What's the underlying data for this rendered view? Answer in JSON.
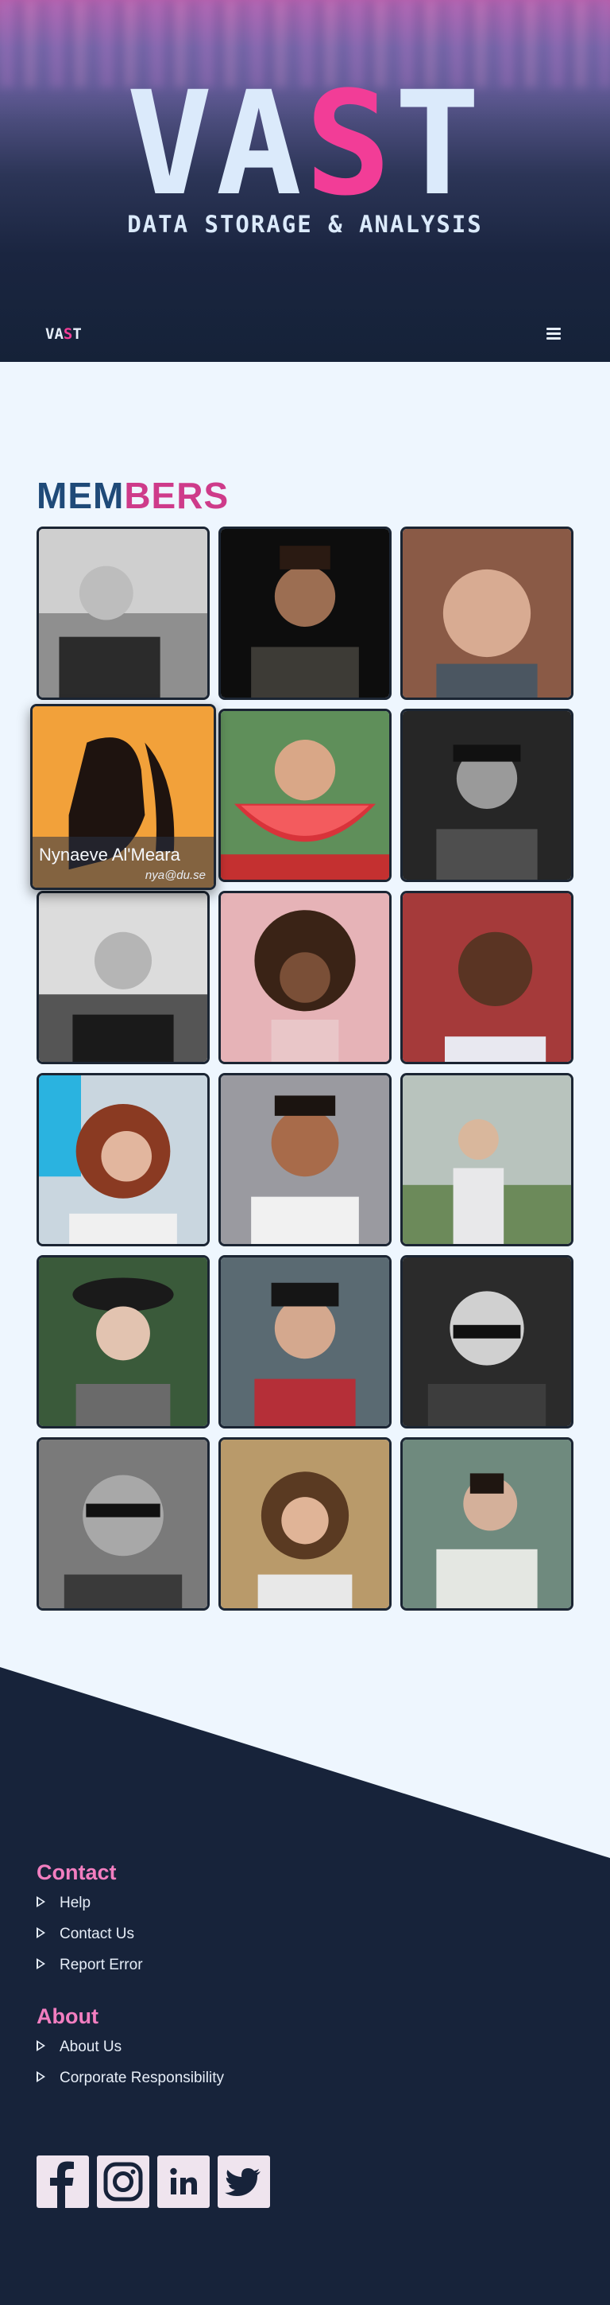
{
  "hero": {
    "title_part1": "VA",
    "title_accent": "S",
    "title_part2": "T",
    "subtitle": "DATA STORAGE & ANALYSIS"
  },
  "nav": {
    "logo_part1": "VA",
    "logo_accent": "S",
    "logo_part2": "T",
    "menu_icon": "hamburger-icon"
  },
  "members": {
    "heading_part1": "MEM",
    "heading_part2": "BERS",
    "hovered_member": {
      "name": "Nynaeve Al'Meara",
      "email": "nya@du.se"
    },
    "count": 18
  },
  "footer": {
    "contact_heading": "Contact",
    "contact_links": [
      "Help",
      "Contact Us",
      "Report Error"
    ],
    "about_heading": "About",
    "about_links": [
      "About Us",
      "Corporate Responsibility"
    ],
    "social_icons": [
      "facebook-icon",
      "instagram-icon",
      "linkedin-icon",
      "twitter-icon"
    ]
  },
  "colors": {
    "accent_pink": "#f23d97",
    "navy": "#17233a",
    "page_bg": "#eef6fe",
    "footer_heading": "#f27ec0"
  }
}
